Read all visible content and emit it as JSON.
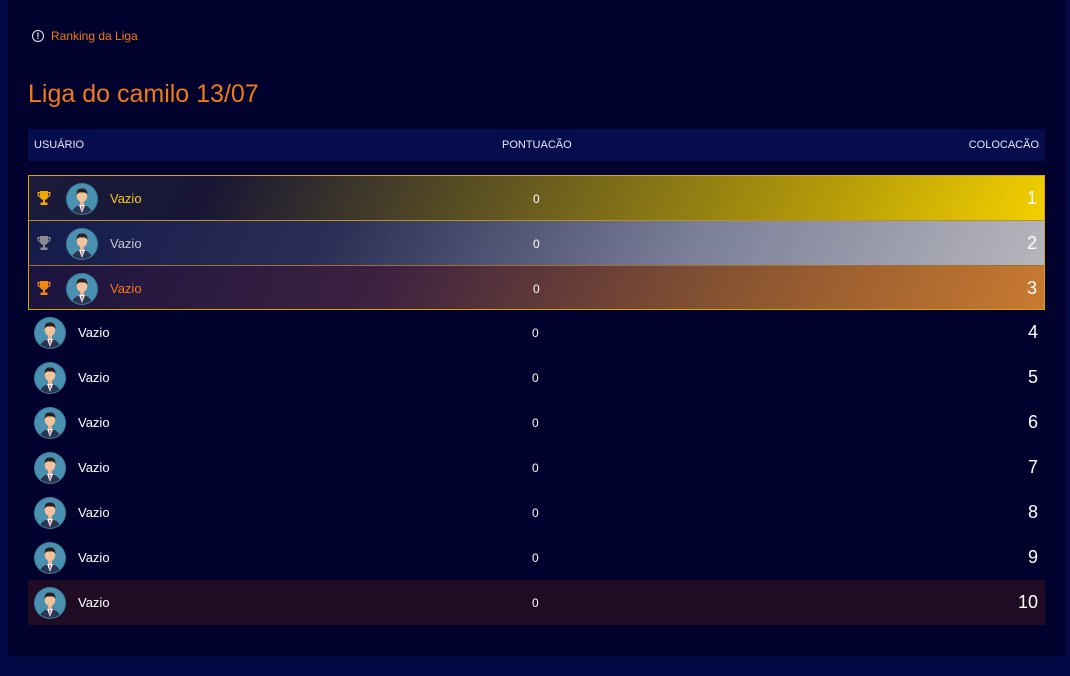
{
  "breadcrumb": {
    "label": "Ranking da Liga",
    "icon": "info-icon"
  },
  "page": {
    "title": "Liga do camilo 13/07"
  },
  "table": {
    "headers": {
      "user": "USUÁRIO",
      "score": "PONTUACÃO",
      "rank": "COLOCACÃO"
    },
    "rows": [
      {
        "name": "Vazio",
        "score": "0",
        "rank": "1"
      },
      {
        "name": "Vazio",
        "score": "0",
        "rank": "2"
      },
      {
        "name": "Vazio",
        "score": "0",
        "rank": "3"
      },
      {
        "name": "Vazio",
        "score": "0",
        "rank": "4"
      },
      {
        "name": "Vazio",
        "score": "0",
        "rank": "5"
      },
      {
        "name": "Vazio",
        "score": "0",
        "rank": "6"
      },
      {
        "name": "Vazio",
        "score": "0",
        "rank": "7"
      },
      {
        "name": "Vazio",
        "score": "0",
        "rank": "8"
      },
      {
        "name": "Vazio",
        "score": "0",
        "rank": "9"
      },
      {
        "name": "Vazio",
        "score": "0",
        "rank": "10"
      }
    ]
  },
  "colors": {
    "accent": "#f07a1a",
    "gold": "#f3d000",
    "silver": "#b6b6bc",
    "bronze": "#c97a30",
    "background": "#01012e"
  }
}
